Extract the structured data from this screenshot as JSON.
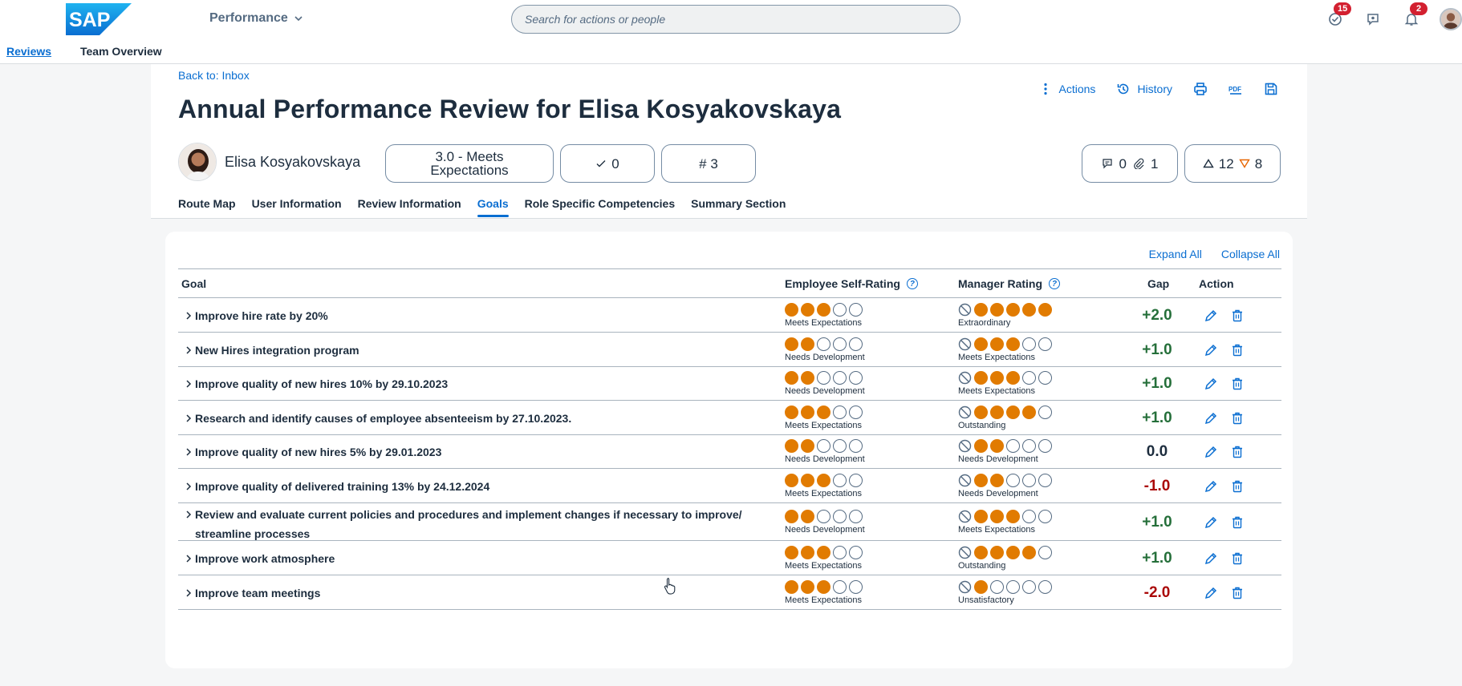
{
  "shell": {
    "logo_text": "SAP",
    "app_title": "Performance",
    "search_placeholder": "Search for actions or people",
    "badges": {
      "tasks": "15",
      "notifications": "2"
    }
  },
  "nav": {
    "reviews": "Reviews",
    "team": "Team Overview"
  },
  "header": {
    "back": "Back to: Inbox",
    "title": "Annual Performance Review for Elisa Kosyakovskaya",
    "actions": {
      "actions": "Actions",
      "history": "History"
    },
    "employee": "Elisa Kosyakovskaya",
    "rating_line1": "3.0 - Meets",
    "rating_line2": "Expectations",
    "check_count": "0",
    "hash_count": "# 3",
    "comments": "0",
    "attachments": "1",
    "up_count": "12",
    "down_count": "8"
  },
  "tabs": [
    "Route Map",
    "User Information",
    "Review Information",
    "Goals",
    "Role Specific Competencies",
    "Summary Section"
  ],
  "goals_card": {
    "expand_all": "Expand All",
    "collapse_all": "Collapse All",
    "columns": {
      "goal": "Goal",
      "self": "Employee Self-Rating",
      "manager": "Manager Rating",
      "gap": "Gap",
      "action": "Action"
    },
    "rows": [
      {
        "goal": "Improve hire rate by 20%",
        "self_stars": 3,
        "self_label": "Meets Expectations",
        "mgr_stars": 5,
        "mgr_label": "Extraordinary",
        "gap": "+2.0",
        "gap_color": "#256f3a"
      },
      {
        "goal": "New Hires integration program",
        "self_stars": 2,
        "self_label": "Needs Development",
        "mgr_stars": 3,
        "mgr_label": "Meets Expectations",
        "gap": "+1.0",
        "gap_color": "#256f3a"
      },
      {
        "goal": "Improve quality of new hires 10% by 29.10.2023",
        "self_stars": 2,
        "self_label": "Needs Development",
        "mgr_stars": 3,
        "mgr_label": "Meets Expectations",
        "gap": "+1.0",
        "gap_color": "#256f3a"
      },
      {
        "goal": "Research and identify causes of employee absenteeism by 27.10.2023.",
        "self_stars": 3,
        "self_label": "Meets Expectations",
        "mgr_stars": 4,
        "mgr_label": "Outstanding",
        "gap": "+1.0",
        "gap_color": "#256f3a"
      },
      {
        "goal": "Improve quality of new hires 5% by 29.01.2023",
        "self_stars": 2,
        "self_label": "Needs Development",
        "mgr_stars": 2,
        "mgr_label": "Needs Development",
        "gap": "0.0",
        "gap_color": "#1d2d3e"
      },
      {
        "goal": "Improve quality of delivered training 13% by 24.12.2024",
        "self_stars": 3,
        "self_label": "Meets Expectations",
        "mgr_stars": 2,
        "mgr_label": "Needs Development",
        "gap": "-1.0",
        "gap_color": "#aa0808"
      },
      {
        "goal": "Review and evaluate current policies and procedures and implement changes if necessary to improve/ streamline processes",
        "goal_line1": "Review and evaluate current policies and procedures and implement changes if necessary to improve/",
        "goal_line2": "streamline processes",
        "self_stars": 2,
        "self_label": "Needs Development",
        "mgr_stars": 3,
        "mgr_label": "Meets Expectations",
        "gap": "+1.0",
        "gap_color": "#256f3a"
      },
      {
        "goal": "Improve work atmosphere",
        "self_stars": 3,
        "self_label": "Meets Expectations",
        "mgr_stars": 4,
        "mgr_label": "Outstanding",
        "gap": "+1.0",
        "gap_color": "#256f3a"
      },
      {
        "goal": "Improve team meetings",
        "self_stars": 3,
        "self_label": "Meets Expectations",
        "mgr_stars": 1,
        "mgr_label": "Unsatisfactory",
        "gap": "-2.0",
        "gap_color": "#aa0808"
      }
    ]
  },
  "colors": {
    "accent": "#0a6ed1",
    "rating_fill": "#e17b01",
    "positive": "#256f3a",
    "negative": "#aa0808"
  }
}
